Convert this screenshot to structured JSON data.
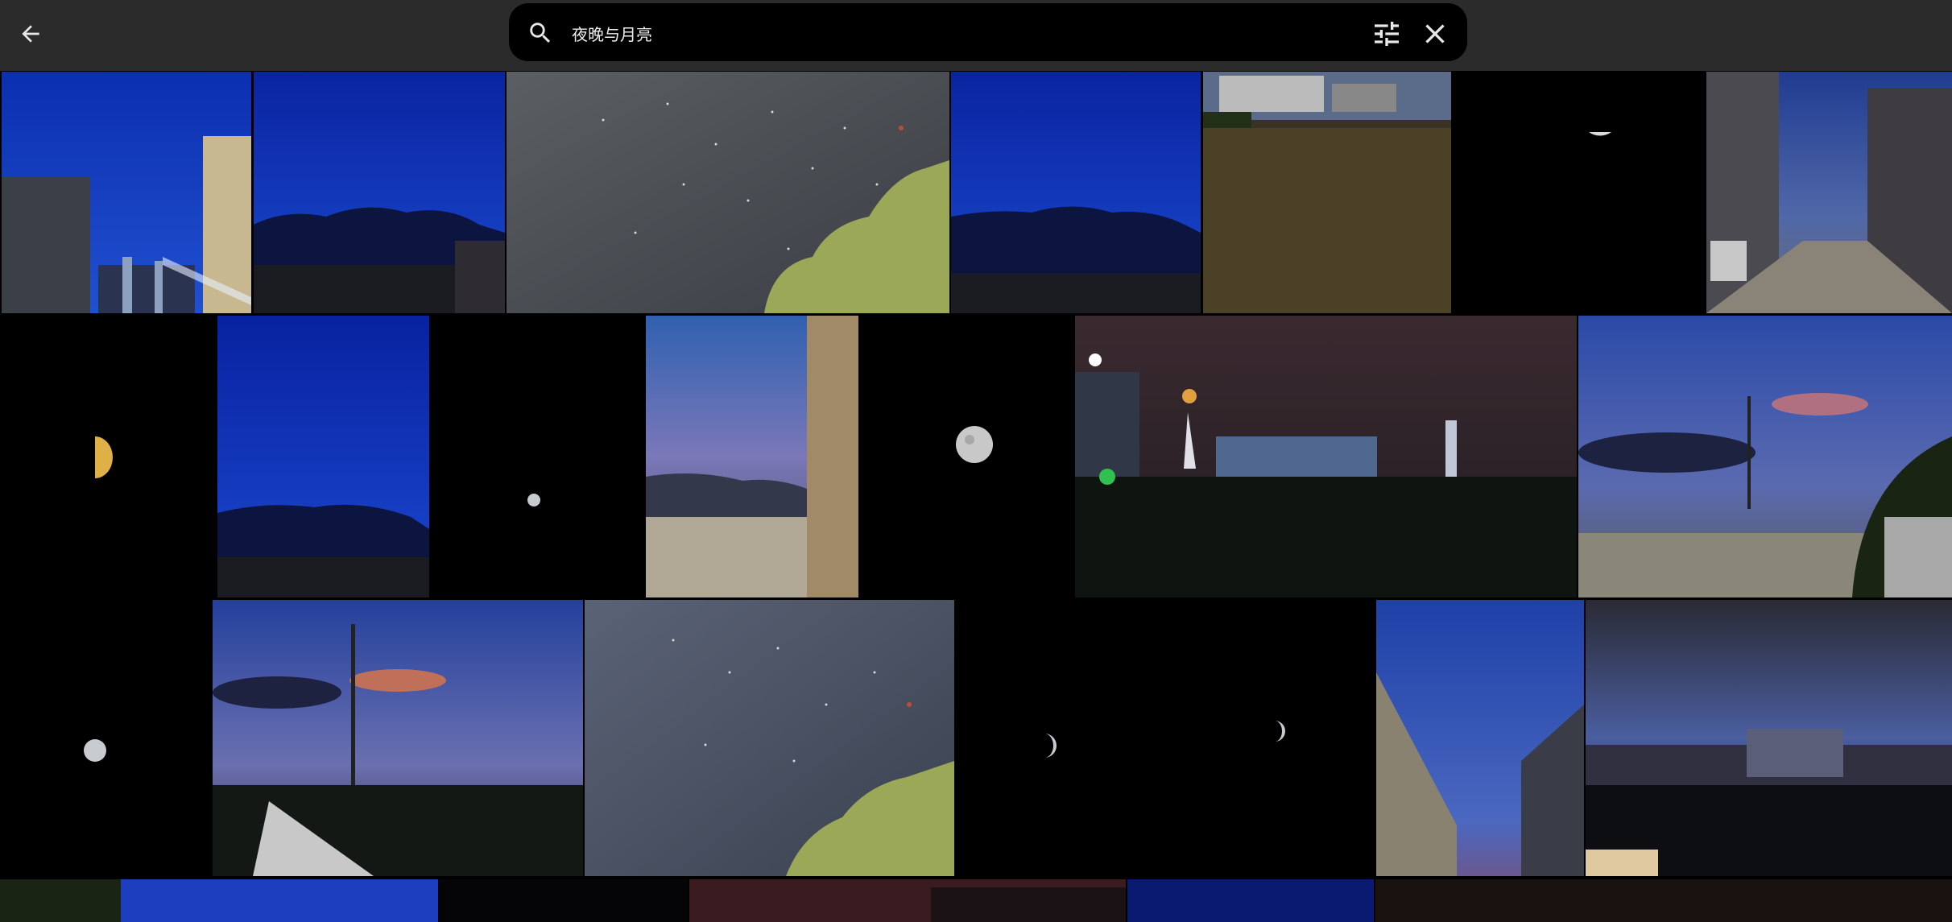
{
  "header": {
    "back_icon": "arrow-back-icon",
    "search_icon": "search-icon",
    "query": "夜晚与月亮",
    "filter_icon": "tune-icon",
    "clear_icon": "close-icon"
  },
  "colors": {
    "topbar": "#2b2b2b",
    "search_field": "#000000",
    "icon": "#e8e8e8",
    "deep_blue_sky": "#0a2aa8",
    "night": "#000000"
  },
  "photos": [
    "blue-sky-street-buildings",
    "blue-sky-dark-clouds",
    "starry-sky-tree",
    "blue-sky-dark-clouds",
    "evening-lawn-apartments",
    "half-moon-black-sky",
    "street-parked-cars-dusk",
    "golden-half-moon",
    "blue-sky-dark-clouds",
    "small-moon-black-sky",
    "dusk-sky-tower",
    "full-moon",
    "park-at-night-city-lights",
    "dusk-clouds-power-pole",
    "small-moon",
    "dusk-power-lines-fence",
    "starry-sky-tree",
    "two-moons",
    "blue-sky-buildings",
    "dusk-lake-buildings",
    "tree-blue-sky",
    "dark-night",
    "red-dusk-silhouette",
    "blue-night",
    "dark-dusk"
  ]
}
